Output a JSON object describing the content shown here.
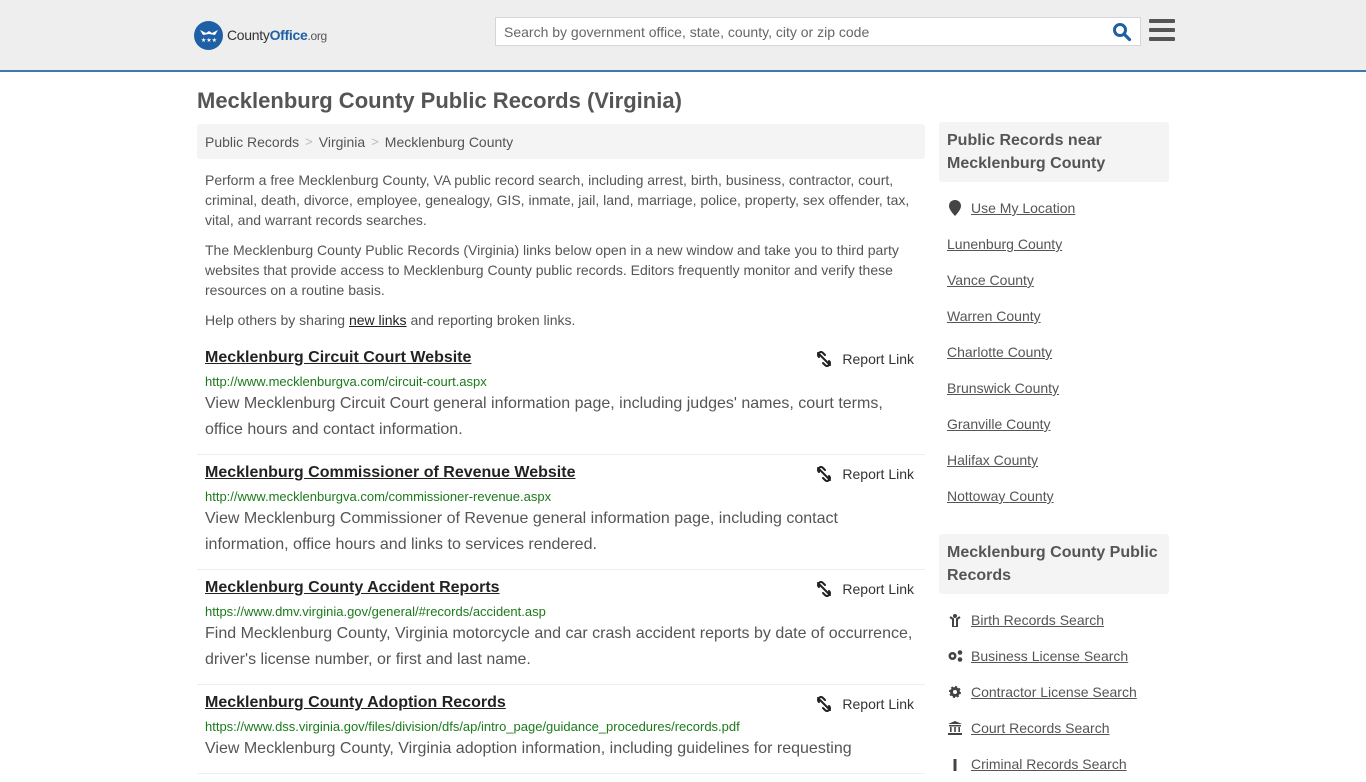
{
  "header": {
    "logo": {
      "name": "County",
      "brand": "Office",
      "tld": ".org"
    },
    "search_placeholder": "Search by government office, state, county, city or zip code",
    "accent_color": "#1f5fa6"
  },
  "page_title": "Mecklenburg County Public Records (Virginia)",
  "breadcrumb": [
    "Public Records",
    "Virginia",
    "Mecklenburg County"
  ],
  "intro": {
    "p1": "Perform a free Mecklenburg County, VA public record search, including arrest, birth, business, contractor, court, criminal, death, divorce, employee, genealogy, GIS, inmate, jail, land, marriage, police, property, sex offender, tax, vital, and warrant records searches.",
    "p2": "The Mecklenburg County Public Records (Virginia) links below open in a new window and take you to third party websites that provide access to Mecklenburg County public records. Editors frequently monitor and verify these resources on a routine basis.",
    "p3_before": "Help others by sharing ",
    "p3_link": "new links",
    "p3_after": " and reporting broken links."
  },
  "report_label": "Report Link",
  "records": [
    {
      "title": "Mecklenburg Circuit Court Website",
      "url": "http://www.mecklenburgva.com/circuit-court.aspx",
      "desc": "View Mecklenburg Circuit Court general information page, including judges' names, court terms, office hours and contact information."
    },
    {
      "title": "Mecklenburg Commissioner of Revenue Website",
      "url": "http://www.mecklenburgva.com/commissioner-revenue.aspx",
      "desc": "View Mecklenburg Commissioner of Revenue general information page, including contact information, office hours and links to services rendered."
    },
    {
      "title": "Mecklenburg County Accident Reports",
      "url": "https://www.dmv.virginia.gov/general/#records/accident.asp",
      "desc": "Find Mecklenburg County, Virginia motorcycle and car crash accident reports by date of occurrence, driver's license number, or first and last name."
    },
    {
      "title": "Mecklenburg County Adoption Records",
      "url": "https://www.dss.virginia.gov/files/division/dfs/ap/intro_page/guidance_procedures/records.pdf",
      "desc": "View Mecklenburg County, Virginia adoption information, including guidelines for requesting"
    }
  ],
  "sidebar": {
    "nearby_heading": "Public Records near Mecklenburg County",
    "use_location": "Use My Location",
    "nearby": [
      "Lunenburg County",
      "Vance County",
      "Warren County",
      "Charlotte County",
      "Brunswick County",
      "Granville County",
      "Halifax County",
      "Nottoway County"
    ],
    "records_heading": "Mecklenburg County Public Records",
    "record_links": [
      {
        "label": "Birth Records Search",
        "icon": "baby-icon"
      },
      {
        "label": "Business License Search",
        "icon": "cogs-icon"
      },
      {
        "label": "Contractor License Search",
        "icon": "gear-icon"
      },
      {
        "label": "Court Records Search",
        "icon": "courthouse-icon"
      },
      {
        "label": "Criminal Records Search",
        "icon": "criminal-icon"
      }
    ]
  }
}
